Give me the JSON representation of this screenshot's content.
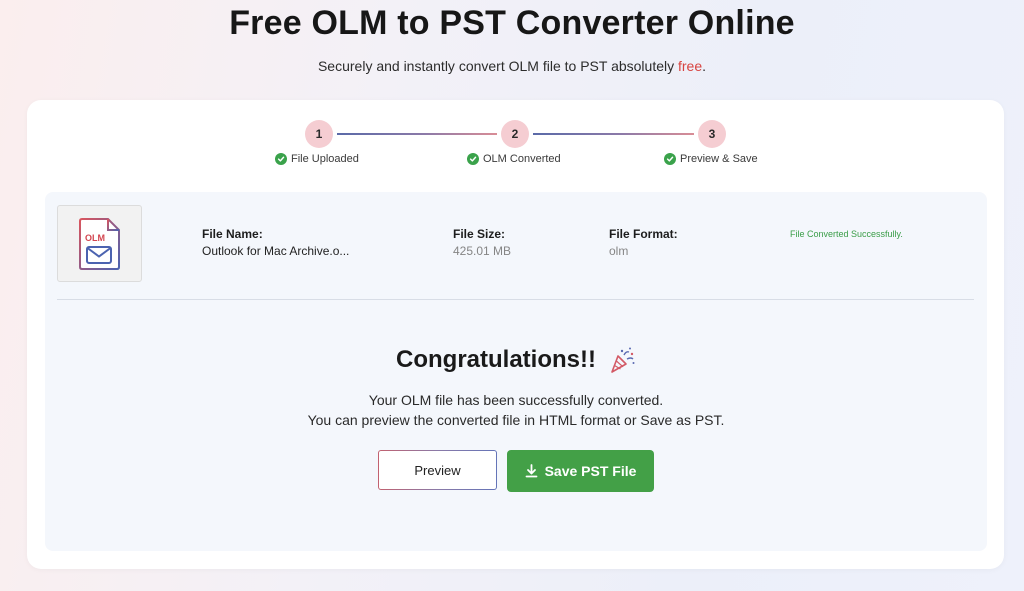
{
  "hero": {
    "title": "Free OLM to PST Converter Online",
    "subtitle_before": "Securely and instantly convert OLM file to PST absolutely ",
    "subtitle_highlight": "free",
    "subtitle_after": "."
  },
  "stepper": {
    "steps": [
      {
        "number": "1",
        "label": "File Uploaded",
        "done": true
      },
      {
        "number": "2",
        "label": "OLM Converted",
        "done": true
      },
      {
        "number": "3",
        "label": "Preview & Save",
        "done": true
      }
    ]
  },
  "file": {
    "icon_text": "OLM",
    "name_label": "File Name:",
    "name_value": "Outlook for Mac Archive.o...",
    "size_label": "File Size:",
    "size_value": "425.01 MB",
    "format_label": "File Format:",
    "format_value": "olm",
    "status": "File Converted Successfully."
  },
  "result": {
    "heading": "Congratulations!!",
    "line1": "Your OLM file has been successfully converted.",
    "line2": "You can preview the converted file in HTML format or Save as PST.",
    "preview_label": "Preview",
    "save_label": "Save PST File"
  },
  "colors": {
    "accent_red": "#d8433f",
    "step_circle": "#f5cdd2",
    "success_green": "#43a047"
  }
}
